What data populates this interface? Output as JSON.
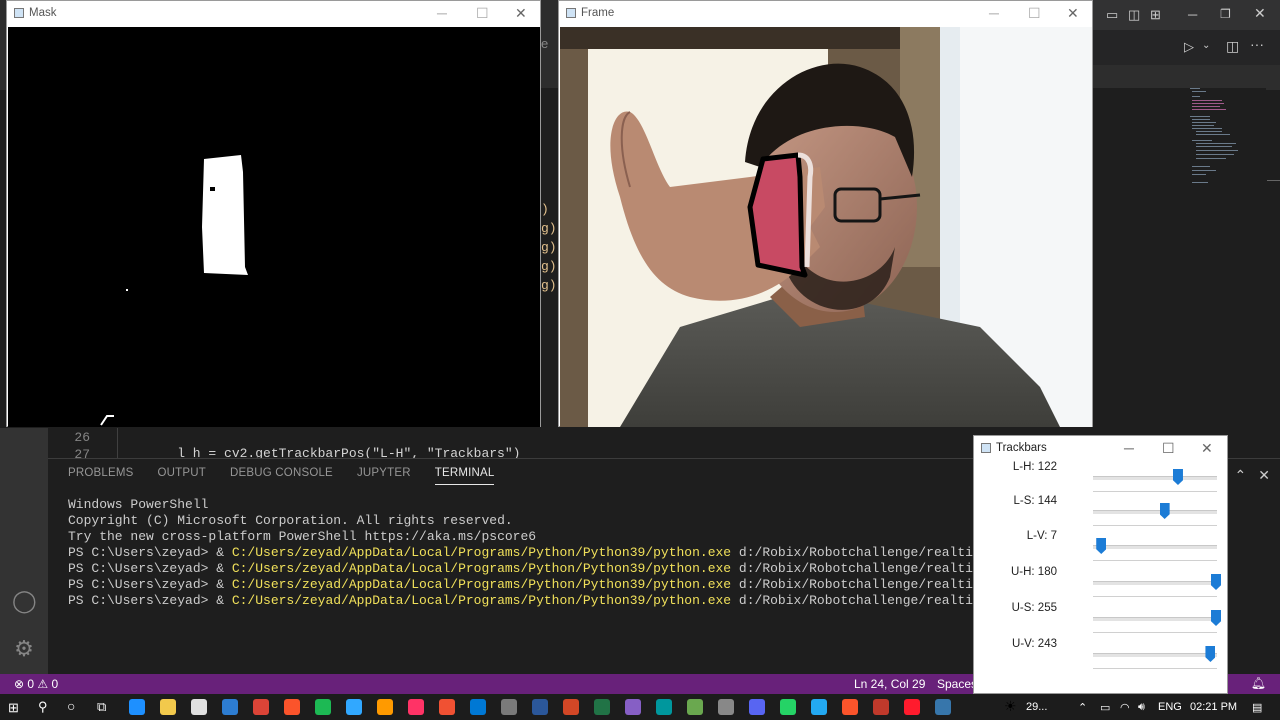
{
  "vscode": {
    "code_right_edges": [
      ")",
      "g)",
      "g)",
      "g)",
      "g)"
    ],
    "line_numbers": [
      "26",
      "27"
    ],
    "line_27_code": "    l_h = cv2.getTrackbarPos(\"L-H\", \"Trackbars\")",
    "partial_title_fragment": "e"
  },
  "panel": {
    "tabs": [
      "PROBLEMS",
      "OUTPUT",
      "DEBUG CONSOLE",
      "JUPYTER",
      "TERMINAL"
    ],
    "active_tab": "TERMINAL",
    "terminal": {
      "lines": [
        "Windows PowerShell",
        "Copyright (C) Microsoft Corporation. All rights reserved.",
        "",
        "Try the new cross-platform PowerShell https://aka.ms/pscore6",
        ""
      ],
      "prompt": "PS C:\\Users\\zeyad> & ",
      "exe": "C:/Users/zeyad/AppData/Local/Programs/Python/Python39/python.exe",
      "script": " d:/Robix/Robotchallenge/realtime_shape",
      "runs": 4
    }
  },
  "statusbar": {
    "errors": "⊗ 0 ⚠ 0",
    "position": "Ln 24, Col 29",
    "indent": "Spaces"
  },
  "windows": {
    "mask": {
      "title": "Mask"
    },
    "frame": {
      "title": "Frame"
    },
    "trackbars": {
      "title": "Trackbars",
      "controls": [
        {
          "label": "L-H: 122",
          "value": 122,
          "max": 180
        },
        {
          "label": "L-S: 144",
          "value": 144,
          "max": 255
        },
        {
          "label": "L-V: 7",
          "value": 7,
          "max": 255
        },
        {
          "label": "U-H: 180",
          "value": 180,
          "max": 180
        },
        {
          "label": "U-S: 255",
          "value": 255,
          "max": 255
        },
        {
          "label": "U-V: 243",
          "value": 243,
          "max": 255
        }
      ]
    }
  },
  "taskbar": {
    "weather": "29...",
    "language": "ENG",
    "time": "02:21 PM",
    "apps": [
      "start",
      "search",
      "cortana",
      "task-view",
      "edge",
      "explorer",
      "store",
      "mail",
      "chrome",
      "brave",
      "spotify",
      "photoshop",
      "illustrator",
      "indesign",
      "git-app",
      "outlook",
      "app-generic",
      "word",
      "powerpoint",
      "excel",
      "visual-studio",
      "arduino",
      "minecraft",
      "game",
      "discord",
      "whatsapp",
      "vscode",
      "brave-beta",
      "pdf",
      "opera",
      "python"
    ]
  },
  "colors": {
    "statusbar": "#68217a",
    "trackbar_thumb": "#1c7cd6",
    "terminal_path": "#f0e05a"
  }
}
